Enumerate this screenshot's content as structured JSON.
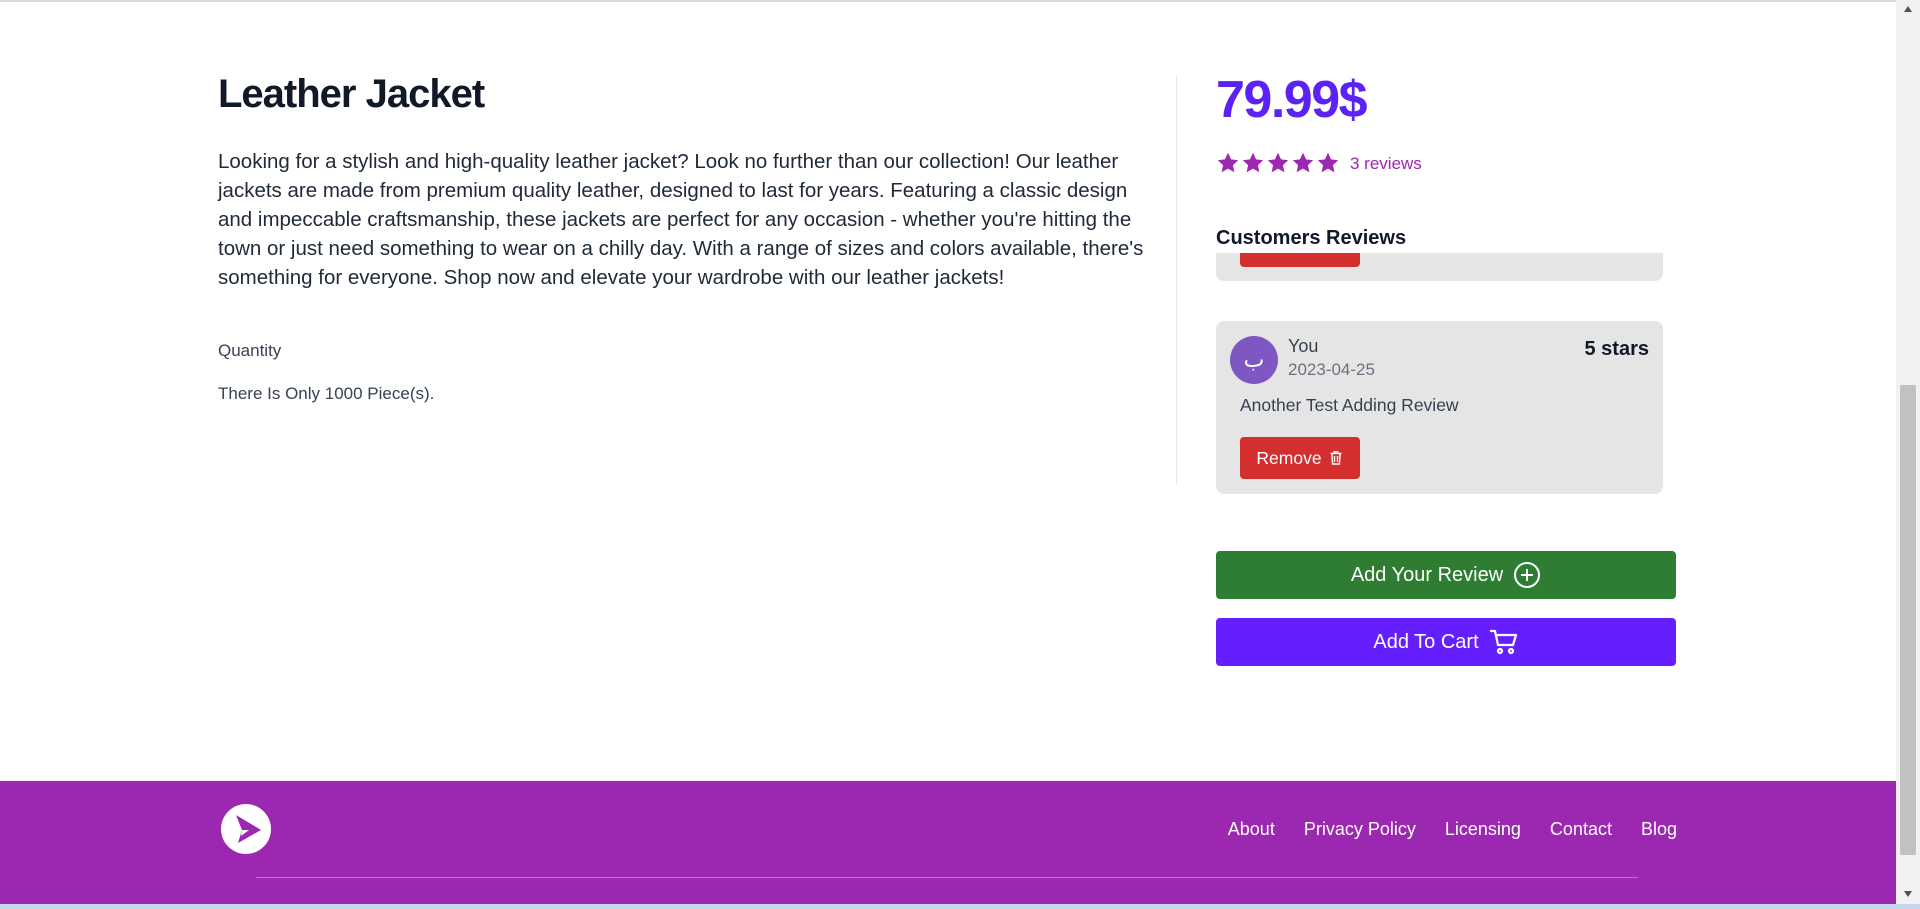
{
  "product": {
    "title": "Leather Jacket",
    "description": "Looking for a stylish and high-quality leather jacket? Look no further than our collection! Our leather jackets are made from premium quality leather, designed to last for years. Featuring a classic design and impeccable craftsmanship, these jackets are perfect for any occasion - whether you're hitting the town or just need something to wear on a chilly day. With a range of sizes and colors available, there's something for everyone. Shop now and elevate your wardrobe with our leather jackets!",
    "quantity_label": "Quantity",
    "stock_text": "There Is Only 1000 Piece(s).",
    "price": "79.99$",
    "rating_stars": 5,
    "reviews_link": "3 reviews"
  },
  "reviews": {
    "heading": "Customers Reviews",
    "items": [
      {
        "avatar_letter": "ب",
        "author": "You",
        "date": "2023-04-25",
        "rating": "5 stars",
        "text": "Another Test Adding Review",
        "remove_label": "Remove"
      }
    ]
  },
  "actions": {
    "add_review_label": "Add Your Review",
    "add_to_cart_label": "Add To Cart"
  },
  "footer": {
    "links": [
      "About",
      "Privacy Policy",
      "Licensing",
      "Contact",
      "Blog"
    ]
  },
  "colors": {
    "accent": "#5b21f5",
    "footer": "#9c27b0",
    "review_button": "#2e7d32",
    "cart_button": "#651fff",
    "remove_button": "#d32f2f",
    "star": "#9c27b0"
  },
  "icons": {
    "star": "star-icon",
    "trash": "trash-icon",
    "add_review": "plus-circle-icon",
    "cart": "cart-icon",
    "logo": "play-logo-icon"
  }
}
